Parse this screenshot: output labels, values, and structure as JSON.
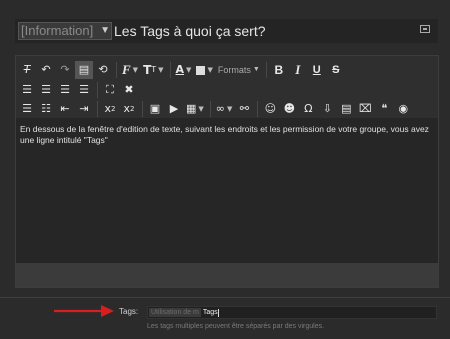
{
  "thread": {
    "prefix": "[Information]",
    "title": "Les Tags à quoi ça sert?"
  },
  "toolbar": {
    "row1": [
      {
        "name": "clear-format-icon",
        "glyph": "T̸"
      },
      {
        "name": "undo-icon",
        "glyph": "↶"
      },
      {
        "name": "redo-icon",
        "glyph": "↷"
      },
      {
        "name": "paste-icon",
        "glyph": "📋"
      },
      {
        "name": "revert-icon",
        "glyph": "⟲"
      },
      {
        "name": "font-family-icon",
        "glyph": "𝓕"
      },
      {
        "name": "font-size-icon",
        "glyph": "Tт"
      },
      {
        "name": "text-color-icon",
        "glyph": "A"
      },
      {
        "name": "background-color-icon",
        "glyph": "A"
      },
      {
        "name": "formats-dropdown",
        "glyph": "Formats"
      },
      {
        "name": "bold-icon",
        "glyph": "B"
      },
      {
        "name": "italic-icon",
        "glyph": "I"
      },
      {
        "name": "underline-icon",
        "glyph": "U"
      },
      {
        "name": "strikethrough-icon",
        "glyph": "S"
      }
    ],
    "row2": [
      {
        "name": "align-left-icon",
        "glyph": "≡"
      },
      {
        "name": "align-center-icon",
        "glyph": "≡"
      },
      {
        "name": "align-right-icon",
        "glyph": "≡"
      },
      {
        "name": "justify-icon",
        "glyph": "≡"
      },
      {
        "name": "fullscreen-icon",
        "glyph": "⛶"
      },
      {
        "name": "bbcode-icon",
        "glyph": "✖"
      }
    ],
    "row3": [
      {
        "name": "bullet-list-icon",
        "glyph": "☰"
      },
      {
        "name": "numbered-list-icon",
        "glyph": "☷"
      },
      {
        "name": "outdent-icon",
        "glyph": "⇤"
      },
      {
        "name": "indent-icon",
        "glyph": "⇥"
      },
      {
        "name": "subscript-icon",
        "glyph": "x₂"
      },
      {
        "name": "superscript-icon",
        "glyph": "x²"
      },
      {
        "name": "image-icon",
        "glyph": "▣"
      },
      {
        "name": "media-icon",
        "glyph": "▶"
      },
      {
        "name": "table-icon",
        "glyph": "▦"
      },
      {
        "name": "link-icon",
        "glyph": "🔗"
      },
      {
        "name": "unlink-icon",
        "glyph": "⚯"
      },
      {
        "name": "smilie-icon",
        "glyph": "☺"
      },
      {
        "name": "emoji-icon",
        "glyph": "☻"
      },
      {
        "name": "special-char-icon",
        "glyph": "Ω"
      },
      {
        "name": "insert-icon",
        "glyph": "⇩"
      },
      {
        "name": "draft-icon",
        "glyph": "▤"
      },
      {
        "name": "code-icon",
        "glyph": "⌧"
      },
      {
        "name": "quote-icon",
        "glyph": "❝"
      },
      {
        "name": "spoiler-icon",
        "glyph": "👁"
      }
    ]
  },
  "editor": {
    "content": "En dessous de la fenêtre d'edition de texte, suivant les endroits et les permission de votre groupe, vous avez une ligne intitulé \"Tags\""
  },
  "tags": {
    "label": "Tags:",
    "chip": "Utilisation de m",
    "typed_value": "Tags",
    "hint": "Les tags multiples peuvent être séparés par des virgules."
  },
  "colors": {
    "arrow": "#d81f1f",
    "background": "#2b2b2b"
  }
}
